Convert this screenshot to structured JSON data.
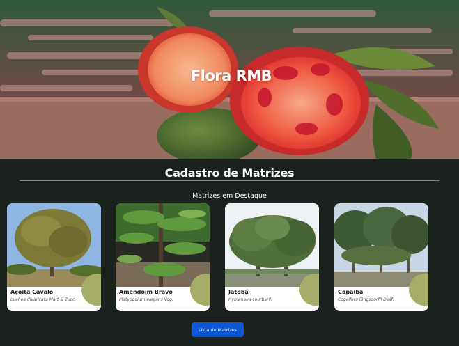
{
  "hero": {
    "title": "Flora RMB"
  },
  "main": {
    "section_title": "Cadastro de Matrizes",
    "featured_label": "Matrizes em Destaque",
    "cards": [
      {
        "name": "Açoita Cavalo",
        "scientific_name": "Luehea divaricata Mart & Zucc."
      },
      {
        "name": "Amendoim Bravo",
        "scientific_name": "Platypodium elegans Vog."
      },
      {
        "name": "Jatobá",
        "scientific_name": "Hymenaea courbaril."
      },
      {
        "name": "Copaiba",
        "scientific_name": "Copaifera lBngsdorffi Desf."
      }
    ],
    "list_button_label": "Lista de Matrizes"
  },
  "colors": {
    "page_background": "#1b211d",
    "card_accent": "#a5ad68",
    "button": "#0d57d6"
  }
}
